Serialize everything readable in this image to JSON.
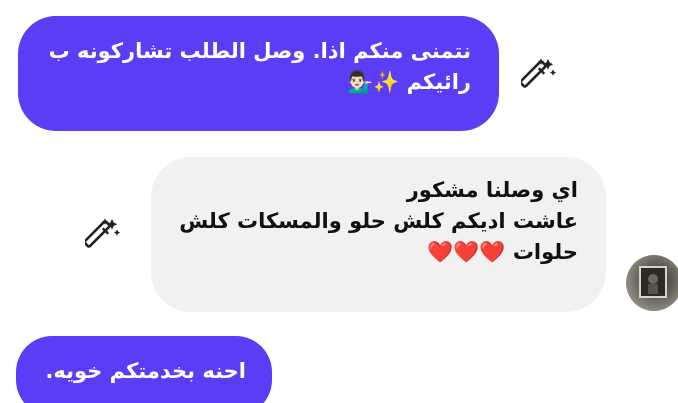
{
  "messages": [
    {
      "direction": "outgoing",
      "lines": [
        "نتمنى منكم اذا. وصل الطلب تشاركونه ب",
        "رائيكم ✨💁🏻‍♂️"
      ]
    },
    {
      "direction": "incoming",
      "lines": [
        "اي وصلنا مشكور",
        "عاشت اديكم كلش حلو والمسكات كلش",
        "حلوات ❤️❤️❤️"
      ]
    },
    {
      "direction": "outgoing",
      "lines": [
        "احنه بخدمتكم خويه."
      ]
    }
  ],
  "colors": {
    "outgoing_bubble": "#5b3df5",
    "incoming_bubble": "#f1f1f1",
    "heart": "#e0101c"
  },
  "icons": {
    "magic": "magic-wand-icon",
    "sparkles": "sparkles-emoji",
    "person": "person-tipping-hand-emoji",
    "heart": "red-heart-emoji"
  }
}
